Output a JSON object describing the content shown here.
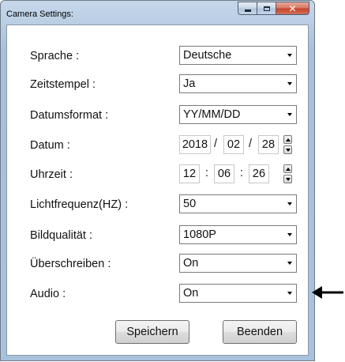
{
  "window": {
    "title": "Camera Settings:"
  },
  "fields": {
    "sprache": {
      "label": "Sprache :",
      "value": "Deutsche"
    },
    "zeitstempel": {
      "label": "Zeitstempel :",
      "value": "Ja"
    },
    "datumsformat": {
      "label": "Datumsformat :",
      "value": "YY/MM/DD"
    },
    "datum": {
      "label": "Datum :",
      "year": "2018",
      "month": "02",
      "day": "28",
      "separator": "/"
    },
    "uhrzeit": {
      "label": "Uhrzeit :",
      "hour": "12",
      "minute": "06",
      "second": "26",
      "separator": ":"
    },
    "lichtfrequenz": {
      "label": "Lichtfrequenz(HZ) :",
      "value": "50"
    },
    "bildqualitaet": {
      "label": "Bildqualität :",
      "value": "1080P"
    },
    "ueberschreiben": {
      "label": "Überschreiben :",
      "value": "On"
    },
    "audio": {
      "label": "Audio :",
      "value": "On"
    }
  },
  "buttons": {
    "save": "Speichern",
    "exit": "Beenden"
  }
}
